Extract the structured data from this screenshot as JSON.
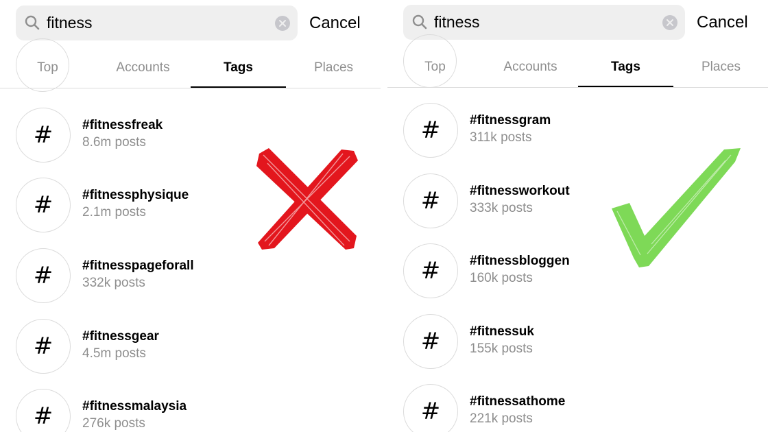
{
  "left_panel": {
    "search": {
      "query": "fitness"
    },
    "cancel_label": "Cancel",
    "tabs": [
      {
        "label": "Top"
      },
      {
        "label": "Accounts"
      },
      {
        "label": "Tags"
      },
      {
        "label": "Places"
      }
    ],
    "active_tab": "Tags",
    "results": [
      {
        "tag": "#fitnessfreak",
        "posts": "8.6m posts"
      },
      {
        "tag": "#fitnessphysique",
        "posts": "2.1m posts"
      },
      {
        "tag": "#fitnesspageforall",
        "posts": "332k posts"
      },
      {
        "tag": "#fitnessgear",
        "posts": "4.5m posts"
      },
      {
        "tag": "#fitnessmalaysia",
        "posts": "276k posts"
      }
    ],
    "overlay_mark": "red-x-mark",
    "overlay_color": "#e3161d"
  },
  "right_panel": {
    "search": {
      "query": "fitness"
    },
    "cancel_label": "Cancel",
    "tabs": [
      {
        "label": "Top"
      },
      {
        "label": "Accounts"
      },
      {
        "label": "Tags"
      },
      {
        "label": "Places"
      }
    ],
    "active_tab": "Tags",
    "results": [
      {
        "tag": "#fitnessgram",
        "posts": "311k posts"
      },
      {
        "tag": "#fitnessworkout",
        "posts": "333k posts"
      },
      {
        "tag": "#fitnessbloggen",
        "posts": "160k posts"
      },
      {
        "tag": "#fitnessuk",
        "posts": "155k posts"
      },
      {
        "tag": "#fitnessathome",
        "posts": "221k posts"
      }
    ],
    "overlay_mark": "green-checkmark",
    "overlay_color": "#7ed957"
  },
  "hash_symbol": "#"
}
